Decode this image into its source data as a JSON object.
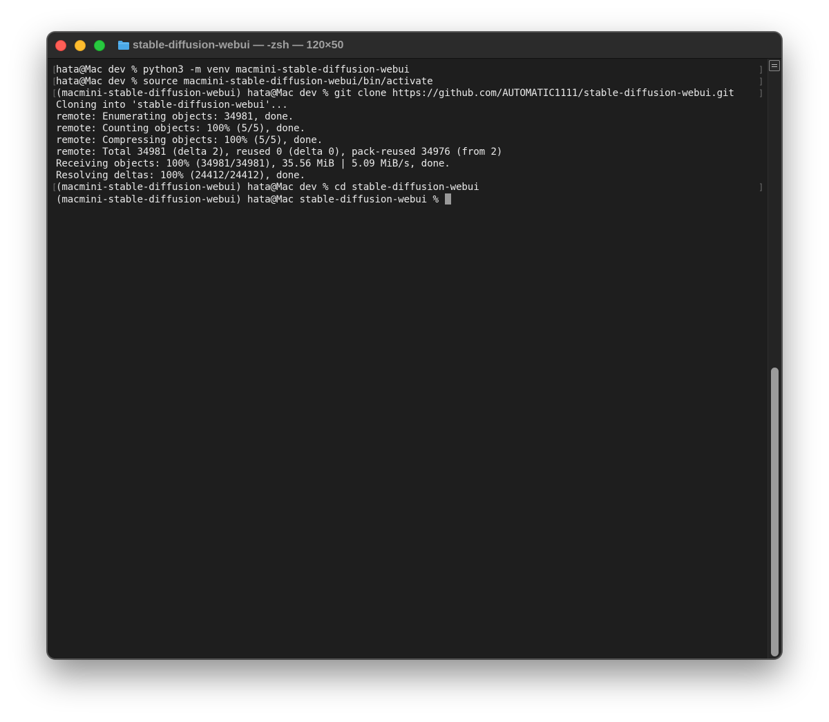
{
  "window": {
    "title": "stable-diffusion-webui — -zsh — 120×50",
    "folder_icon": "folder-icon",
    "controls": {
      "close": "close-button",
      "minimize": "minimize-button",
      "zoom": "zoom-button"
    }
  },
  "terminal": {
    "lines": [
      "hata@Mac dev % python3 -m venv macmini-stable-diffusion-webui",
      "hata@Mac dev % source macmini-stable-diffusion-webui/bin/activate",
      "(macmini-stable-diffusion-webui) hata@Mac dev % git clone https://github.com/AUTOMATIC1111/stable-diffusion-webui.git",
      "Cloning into 'stable-diffusion-webui'...",
      "remote: Enumerating objects: 34981, done.",
      "remote: Counting objects: 100% (5/5), done.",
      "remote: Compressing objects: 100% (5/5), done.",
      "remote: Total 34981 (delta 2), reused 0 (delta 0), pack-reused 34976 (from 2)",
      "Receiving objects: 100% (34981/34981), 35.56 MiB | 5.09 MiB/s, done.",
      "Resolving deltas: 100% (24412/24412), done.",
      "(macmini-stable-diffusion-webui) hata@Mac dev % cd stable-diffusion-webui",
      "(macmini-stable-diffusion-webui) hata@Mac stable-diffusion-webui % "
    ],
    "bracket_open": "[",
    "bracket_close": "]"
  },
  "colors": {
    "background": "#1e1e1e",
    "titlebar": "#2b2b2b",
    "text": "#e8e8e8",
    "close": "#fe5f57",
    "minimize": "#febc2e",
    "zoom": "#28c840",
    "folder": "#4aa8e8"
  }
}
